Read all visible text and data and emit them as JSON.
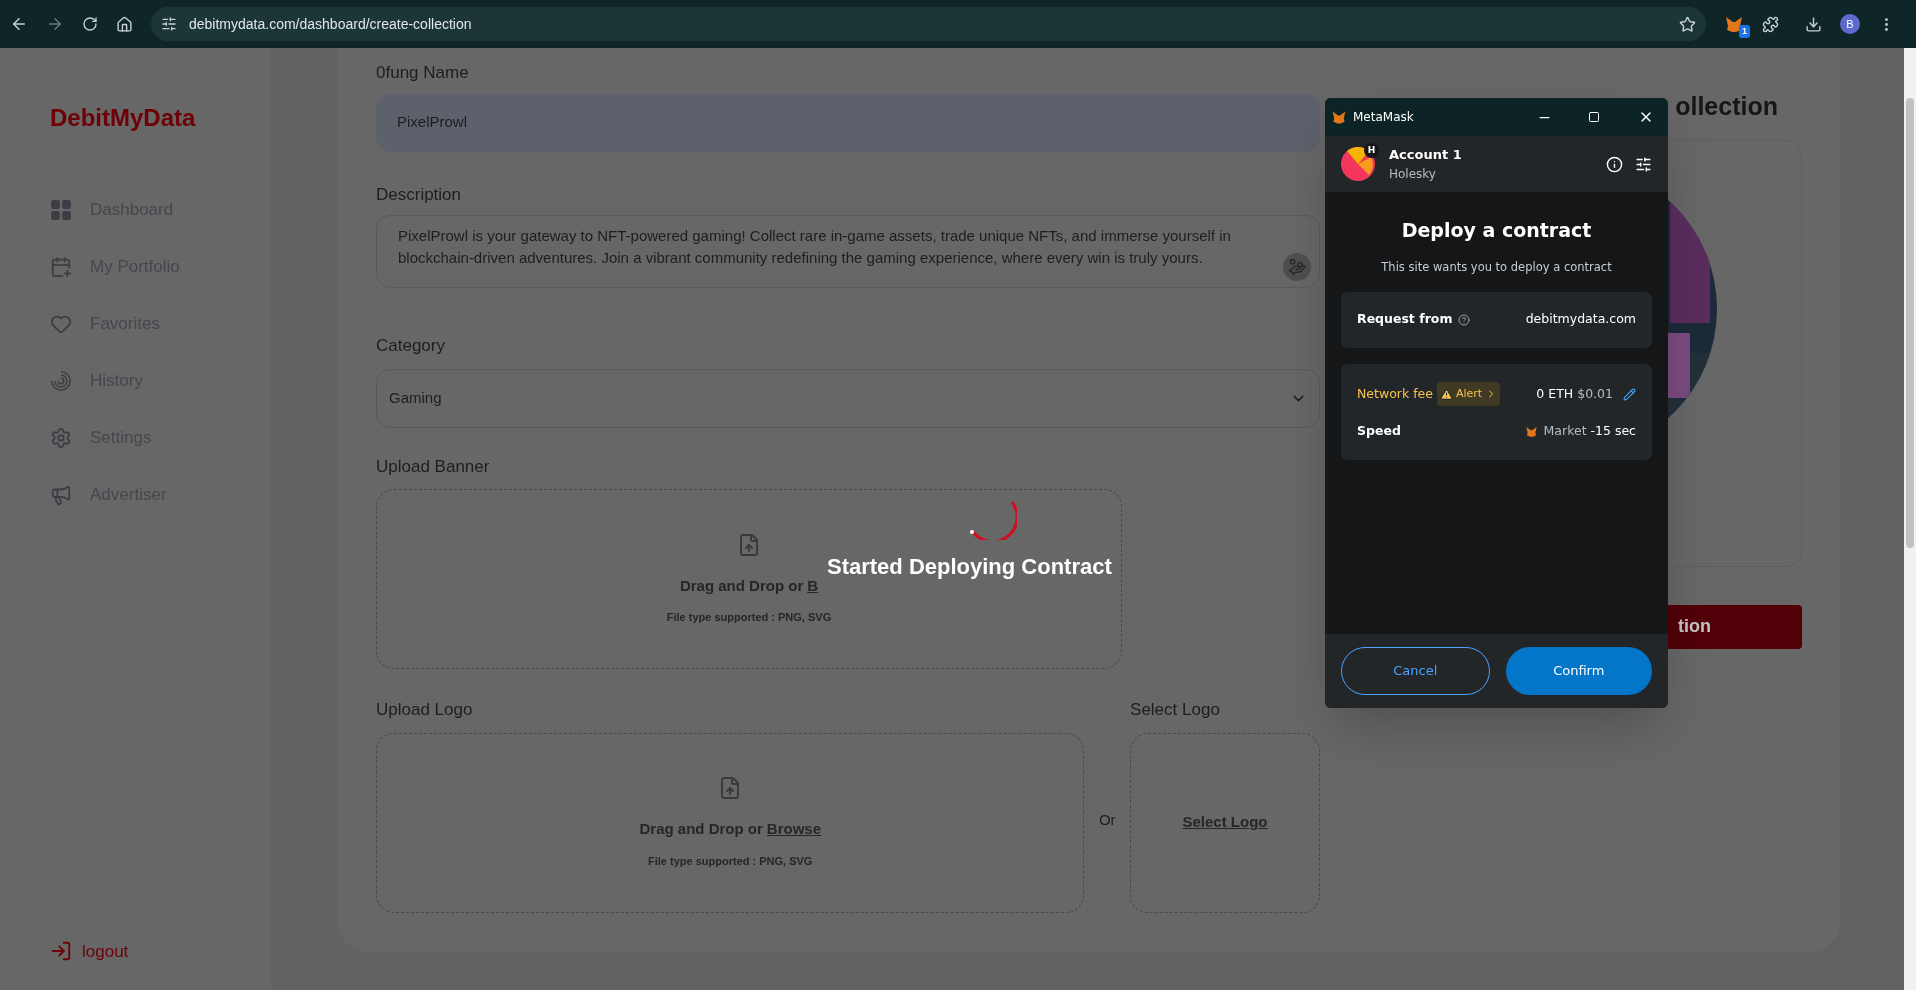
{
  "browser": {
    "url": "debitmydata.com/dashboard/create-collection",
    "extension_badge": "1",
    "profile_initial": "B"
  },
  "sidebar": {
    "logo": "DebitMyData",
    "items": [
      {
        "label": "Dashboard",
        "kind": "grid"
      },
      {
        "label": "My Portfolio",
        "kind": "calendar"
      },
      {
        "label": "Favorites",
        "kind": "heart"
      },
      {
        "label": "History",
        "kind": "spiral"
      },
      {
        "label": "Settings",
        "kind": "gear"
      },
      {
        "label": "Advertiser",
        "kind": "megaphone"
      }
    ],
    "logout": "logout"
  },
  "form": {
    "name_label": "0fung Name",
    "name_value": "PixelProwl",
    "description_label": "Description",
    "description_value": "PixelProwl is your gateway to NFT-powered gaming! Collect rare in-game assets, trade unique NFTs, and immerse yourself in blockchain-driven adventures. Join a vibrant community redefining the gaming experience, where every win is truly yours.",
    "category_label": "Category",
    "category_value": "Gaming",
    "banner_label": "Upload Banner",
    "banner_drop": "Drag and Drop or",
    "banner_browse": "B",
    "banner_hint": "File type supported : PNG, SVG",
    "logo_label": "Upload Logo",
    "logo_drop": "Drag and Drop or",
    "logo_browse": "Browse",
    "logo_hint": "File type supported : PNG, SVG",
    "or": "Or",
    "select_logo_label": "Select Logo",
    "select_logo_link": "Select Logo"
  },
  "preview": {
    "heading": "ollection",
    "button": "tion"
  },
  "overlay": {
    "message": "Started Deploying Contract"
  },
  "metamask": {
    "title": "MetaMask",
    "account": "Account 1",
    "network": "Holesky",
    "network_badge": "H",
    "heading": "Deploy a contract",
    "subtitle": "This site wants you to deploy a contract",
    "request_label": "Request from",
    "request_value": "debitmydata.com",
    "fee_label": "Network fee",
    "alert": "Alert",
    "fee_eth": "0 ETH",
    "fee_usd": "$0.01",
    "speed_label": "Speed",
    "speed_value": "Market",
    "speed_time": "-15 sec",
    "cancel": "Cancel",
    "confirm": "Confirm"
  }
}
